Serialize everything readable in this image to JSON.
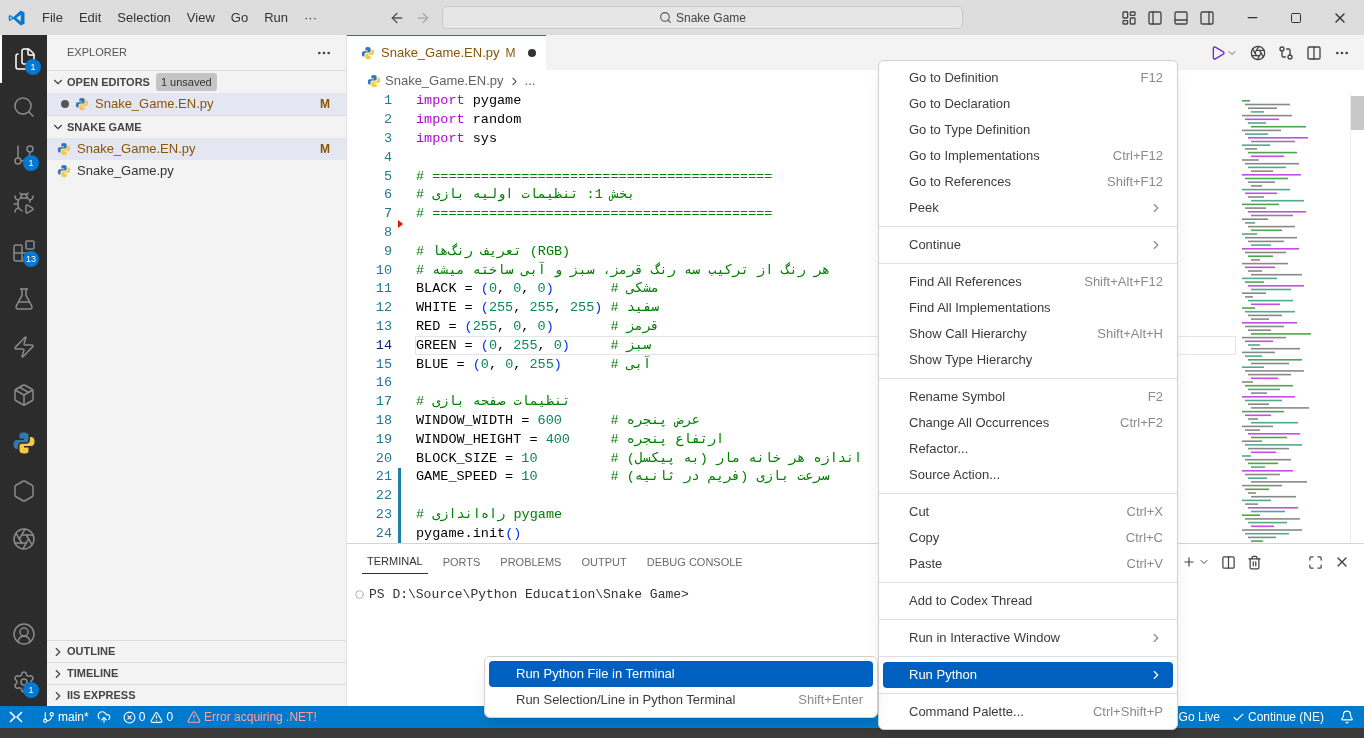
{
  "title_bar": {
    "menu": [
      "File",
      "Edit",
      "Selection",
      "View",
      "Go",
      "Run",
      "···"
    ],
    "search": "Snake Game"
  },
  "activity_bar": {
    "items": [
      {
        "badge": "1",
        "selected": true
      },
      {
        "selected": false
      },
      {
        "badge": "1",
        "selected": false
      },
      {
        "selected": false
      },
      {
        "badge": "13",
        "selected": false
      },
      {
        "selected": false
      },
      {
        "selected": false
      },
      {
        "selected": false
      },
      {
        "selected": false
      },
      {
        "selected": false
      },
      {
        "selected": false
      }
    ],
    "bottom": [
      {
        "selected": false
      },
      {
        "badge": "1",
        "selected": false
      }
    ]
  },
  "sidebar": {
    "title": "EXPLORER",
    "sections": [
      {
        "title": "OPEN EDITORS",
        "expanded": true,
        "badge": "1 unsaved",
        "items": [
          {
            "name": "Snake_Game.EN.py",
            "status": "M",
            "unsaved": true,
            "selected": true
          }
        ]
      },
      {
        "title": "SNAKE GAME",
        "expanded": true,
        "items": [
          {
            "name": "Snake_Game.EN.py",
            "status": "M",
            "selected": true
          },
          {
            "name": "Snake_Game.py",
            "selected": false
          }
        ]
      }
    ],
    "bottom_sections": [
      {
        "title": "OUTLINE",
        "expanded": false
      },
      {
        "title": "TIMELINE",
        "expanded": false
      },
      {
        "title": "IIS EXPRESS",
        "expanded": false
      }
    ]
  },
  "editor": {
    "tabs": [
      {
        "name": "Snake_Game.EN.py",
        "status": "M",
        "unsaved": true,
        "selected": true
      }
    ],
    "breadcrumb": [
      "Snake_Game.EN.py",
      "..."
    ],
    "lines": [
      {
        "number": "1",
        "current": false,
        "modified": false,
        "deleted": false,
        "tokens": [
          {
            "kind": "keyword",
            "text": "import"
          },
          {
            "kind": "plain",
            "text": " pygame"
          }
        ]
      },
      {
        "number": "2",
        "current": false,
        "modified": false,
        "deleted": false,
        "tokens": [
          {
            "kind": "keyword",
            "text": "import"
          },
          {
            "kind": "plain",
            "text": " random"
          }
        ]
      },
      {
        "number": "3",
        "current": false,
        "modified": false,
        "deleted": false,
        "tokens": [
          {
            "kind": "keyword",
            "text": "import"
          },
          {
            "kind": "plain",
            "text": " sys"
          }
        ]
      },
      {
        "number": "4",
        "current": false,
        "modified": false,
        "deleted": false
      },
      {
        "number": "5",
        "current": false,
        "modified": false,
        "deleted": false,
        "tokens": [
          {
            "kind": "comment",
            "text": "# =========================================="
          }
        ]
      },
      {
        "number": "6",
        "current": false,
        "modified": false,
        "deleted": false,
        "tokens": [
          {
            "kind": "comment",
            "text": "# بخش 1: تنظیمات اولیه بازی"
          }
        ]
      },
      {
        "number": "7",
        "current": false,
        "modified": false,
        "deleted": false,
        "tokens": [
          {
            "kind": "comment",
            "text": "# =========================================="
          }
        ]
      },
      {
        "number": "8",
        "current": false,
        "modified": false,
        "deleted": true
      },
      {
        "number": "9",
        "current": false,
        "modified": false,
        "deleted": false,
        "tokens": [
          {
            "kind": "comment",
            "text": "# تعریف رنگ‌ها (RGB)"
          }
        ]
      },
      {
        "number": "10",
        "current": false,
        "modified": false,
        "deleted": false,
        "tokens": [
          {
            "kind": "comment",
            "text": "# هر رنگ از ترکیب سه رنگ قرمز، سبز و آبی ساخته میشه"
          }
        ]
      },
      {
        "number": "11",
        "current": false,
        "modified": false,
        "deleted": false,
        "tokens": [
          {
            "kind": "plain",
            "text": "BLACK = "
          },
          {
            "kind": "bracket",
            "text": "("
          },
          {
            "kind": "number",
            "text": "0"
          },
          {
            "kind": "plain",
            "text": ", "
          },
          {
            "kind": "number",
            "text": "0"
          },
          {
            "kind": "plain",
            "text": ", "
          },
          {
            "kind": "number",
            "text": "0"
          },
          {
            "kind": "bracket",
            "text": ")"
          },
          {
            "kind": "comment",
            "text": "# مشکی"
          }
        ]
      },
      {
        "number": "12",
        "current": false,
        "modified": false,
        "deleted": false,
        "tokens": [
          {
            "kind": "plain",
            "text": "WHITE = "
          },
          {
            "kind": "bracket",
            "text": "("
          },
          {
            "kind": "number",
            "text": "255"
          },
          {
            "kind": "plain",
            "text": ", "
          },
          {
            "kind": "number",
            "text": "255"
          },
          {
            "kind": "plain",
            "text": ", "
          },
          {
            "kind": "number",
            "text": "255"
          },
          {
            "kind": "bracket",
            "text": ")"
          },
          {
            "kind": "comment",
            "text": "# سفید"
          }
        ]
      },
      {
        "number": "13",
        "current": false,
        "modified": false,
        "deleted": false,
        "tokens": [
          {
            "kind": "plain",
            "text": "RED = "
          },
          {
            "kind": "bracket",
            "text": "("
          },
          {
            "kind": "number",
            "text": "255"
          },
          {
            "kind": "plain",
            "text": ", "
          },
          {
            "kind": "number",
            "text": "0"
          },
          {
            "kind": "plain",
            "text": ", "
          },
          {
            "kind": "number",
            "text": "0"
          },
          {
            "kind": "bracket",
            "text": ")"
          },
          {
            "kind": "comment",
            "text": "# قرمز"
          }
        ]
      },
      {
        "number": "14",
        "current": true,
        "modified": false,
        "deleted": false,
        "tokens": [
          {
            "kind": "plain",
            "text": "GREEN = "
          },
          {
            "kind": "bracket",
            "text": "("
          },
          {
            "kind": "number",
            "text": "0"
          },
          {
            "kind": "plain",
            "text": ", "
          },
          {
            "kind": "number",
            "text": "255"
          },
          {
            "kind": "plain",
            "text": ", "
          },
          {
            "kind": "number",
            "text": "0"
          },
          {
            "kind": "bracket",
            "text": ")"
          },
          {
            "kind": "comment",
            "text": "# سبز"
          }
        ]
      },
      {
        "number": "15",
        "current": false,
        "modified": false,
        "deleted": false,
        "tokens": [
          {
            "kind": "plain",
            "text": "BLUE = "
          },
          {
            "kind": "bracket",
            "text": "("
          },
          {
            "kind": "number",
            "text": "0"
          },
          {
            "kind": "plain",
            "text": ", "
          },
          {
            "kind": "number",
            "text": "0"
          },
          {
            "kind": "plain",
            "text": ", "
          },
          {
            "kind": "number",
            "text": "255"
          },
          {
            "kind": "bracket",
            "text": ")"
          },
          {
            "kind": "comment",
            "text": "# آبی"
          }
        ]
      },
      {
        "number": "16",
        "current": false,
        "modified": false,
        "deleted": false
      },
      {
        "number": "17",
        "current": false,
        "modified": false,
        "deleted": false,
        "tokens": [
          {
            "kind": "comment",
            "text": "# تنظیمات صفحه بازی"
          }
        ]
      },
      {
        "number": "18",
        "current": false,
        "modified": false,
        "deleted": false,
        "tokens": [
          {
            "kind": "plain",
            "text": "WINDOW_WIDTH = "
          },
          {
            "kind": "number",
            "text": "600"
          },
          {
            "kind": "comment",
            "text": "# عرض پنجره"
          }
        ]
      },
      {
        "number": "19",
        "current": false,
        "modified": false,
        "deleted": false,
        "tokens": [
          {
            "kind": "plain",
            "text": "WINDOW_HEIGHT = "
          },
          {
            "kind": "number",
            "text": "400"
          },
          {
            "kind": "comment",
            "text": "# ارتفاع پنجره"
          }
        ]
      },
      {
        "number": "20",
        "current": false,
        "modified": false,
        "deleted": false,
        "tokens": [
          {
            "kind": "plain",
            "text": "BLOCK_SIZE = "
          },
          {
            "kind": "number",
            "text": "10"
          },
          {
            "kind": "comment",
            "text": "# اندازه هر خانه مار (به پیکسل)"
          }
        ]
      },
      {
        "number": "21",
        "current": false,
        "modified": true,
        "deleted": false,
        "tokens": [
          {
            "kind": "plain",
            "text": "GAME_SPEED = "
          },
          {
            "kind": "number",
            "text": "10"
          },
          {
            "kind": "comment",
            "text": "# سرعت بازی (فریم در ثانیه)"
          }
        ]
      },
      {
        "number": "22",
        "current": false,
        "modified": true,
        "deleted": false
      },
      {
        "number": "23",
        "current": false,
        "modified": true,
        "deleted": false,
        "tokens": [
          {
            "kind": "comment",
            "text": "# راه‌اندازی pygame"
          }
        ]
      },
      {
        "number": "24",
        "current": false,
        "modified": true,
        "deleted": false,
        "tokens": [
          {
            "kind": "plain",
            "text": "pygame.init"
          },
          {
            "kind": "bracket",
            "text": "()"
          }
        ]
      }
    ]
  },
  "panel": {
    "tabs": [
      {
        "label": "TERMINAL",
        "selected": true
      },
      {
        "label": "PORTS",
        "selected": false
      },
      {
        "label": "PROBLEMS",
        "selected": false
      },
      {
        "label": "OUTPUT",
        "selected": false
      },
      {
        "label": "DEBUG CONSOLE",
        "selected": false
      }
    ],
    "terminal": "PS D:\\Source\\Python Education\\Snake Game>"
  },
  "status_bar": {
    "branch": "main*",
    "errors": "0",
    "warnings": "0",
    "error_message": "Error acquiring .NET!",
    "right": [
      "Go Live",
      "Continue (NE)"
    ]
  },
  "context_menu": {
    "groups": [
      [
        {
          "label": "Go to Definition",
          "shortcut": "F12",
          "submenu": false,
          "selected": false
        },
        {
          "label": "Go to Declaration",
          "submenu": false,
          "selected": false
        },
        {
          "label": "Go to Type Definition",
          "submenu": false,
          "selected": false
        },
        {
          "label": "Go to Implementations",
          "shortcut": "Ctrl+F12",
          "submenu": false,
          "selected": false
        },
        {
          "label": "Go to References",
          "shortcut": "Shift+F12",
          "submenu": false,
          "selected": false
        },
        {
          "label": "Peek",
          "submenu": true,
          "selected": false
        }
      ],
      [
        {
          "label": "Continue",
          "submenu": true,
          "selected": false
        }
      ],
      [
        {
          "label": "Find All References",
          "shortcut": "Shift+Alt+F12",
          "submenu": false,
          "selected": false
        },
        {
          "label": "Find All Implementations",
          "submenu": false,
          "selected": false
        },
        {
          "label": "Show Call Hierarchy",
          "shortcut": "Shift+Alt+H",
          "submenu": false,
          "selected": false
        },
        {
          "label": "Show Type Hierarchy",
          "submenu": false,
          "selected": false
        }
      ],
      [
        {
          "label": "Rename Symbol",
          "shortcut": "F2",
          "submenu": false,
          "selected": false
        },
        {
          "label": "Change All Occurrences",
          "shortcut": "Ctrl+F2",
          "submenu": false,
          "selected": false
        },
        {
          "label": "Refactor...",
          "submenu": false,
          "selected": false
        },
        {
          "label": "Source Action...",
          "submenu": false,
          "selected": false
        }
      ],
      [
        {
          "label": "Cut",
          "shortcut": "Ctrl+X",
          "submenu": false,
          "selected": false
        },
        {
          "label": "Copy",
          "shortcut": "Ctrl+C",
          "submenu": false,
          "selected": false
        },
        {
          "label": "Paste",
          "shortcut": "Ctrl+V",
          "submenu": false,
          "selected": false
        }
      ],
      [
        {
          "label": "Add to Codex Thread",
          "submenu": false,
          "selected": false
        }
      ],
      [
        {
          "label": "Run in Interactive Window",
          "submenu": true,
          "selected": false
        }
      ],
      [
        {
          "label": "Run Python",
          "submenu": true,
          "selected": true
        }
      ],
      [
        {
          "label": "Command Palette...",
          "shortcut": "Ctrl+Shift+P",
          "submenu": false,
          "selected": false
        }
      ]
    ]
  },
  "submenu": {
    "items": [
      {
        "label": "Run Python File in Terminal",
        "submenu": false,
        "selected": true
      },
      {
        "label": "Run Selection/Line in Python Terminal",
        "shortcut": "Shift+Enter",
        "submenu": false,
        "selected": false
      }
    ]
  }
}
